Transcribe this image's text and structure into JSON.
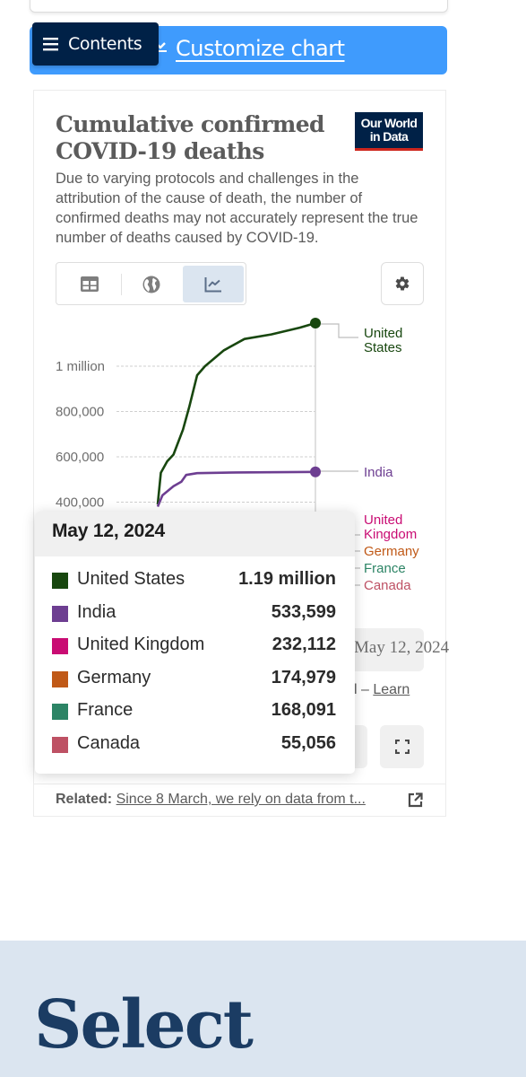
{
  "contents_button": {
    "label": "Contents",
    "icon": "menu-icon"
  },
  "customize": {
    "label": "Customize chart",
    "icon": "chevron-down-icon",
    "color": "#3f9bfd"
  },
  "chart": {
    "title": "Cumulative confirmed COVID-19 deaths",
    "subtitle": "Due to varying protocols and challenges in the attribution of the cause of death, the number of confirmed deaths may not accurately represent the true number of deaths caused by COVID-19.",
    "logo": {
      "line1": "Our World",
      "line2": "in Data"
    },
    "view_tabs": [
      {
        "name": "table",
        "icon": "table-icon",
        "active": false
      },
      {
        "name": "map",
        "icon": "globe-icon",
        "active": false
      },
      {
        "name": "chart",
        "icon": "line-chart-icon",
        "active": true
      }
    ],
    "settings_icon": "gear-icon",
    "date_control": "May 12, 2024",
    "source_line": {
      "prefix": "l – ",
      "link": "Learn"
    },
    "fullscreen_icon": "fullscreen-icon"
  },
  "tooltip": {
    "date": "May 12, 2024",
    "rows": [
      {
        "name": "United States",
        "value": "1.19 million",
        "color": "#18470f"
      },
      {
        "name": "India",
        "value": "533,599",
        "color": "#6d3e91"
      },
      {
        "name": "United Kingdom",
        "value": "232,112",
        "color": "#c90c73"
      },
      {
        "name": "Germany",
        "value": "174,979",
        "color": "#c05917"
      },
      {
        "name": "France",
        "value": "168,091",
        "color": "#2c8465"
      },
      {
        "name": "Canada",
        "value": "55,056",
        "color": "#be5164"
      }
    ]
  },
  "related": {
    "label": "Related:",
    "link": "Since 8 March, we rely on data from t..."
  },
  "select_section": {
    "heading": "Select"
  },
  "chart_data": {
    "type": "line",
    "title": "Cumulative confirmed COVID-19 deaths",
    "xlabel": "",
    "ylabel": "",
    "y_ticks": [
      400000,
      600000,
      800000,
      1000000
    ],
    "y_tick_labels": [
      "400,000",
      "600,000",
      "800,000",
      "1 million"
    ],
    "ylim": [
      0,
      1250000
    ],
    "grid": true,
    "legend": "right",
    "series": [
      {
        "name": "United States",
        "label": [
          "United",
          "States"
        ],
        "color": "#18470f",
        "points": [
          [
            0.0,
            390000
          ],
          [
            0.02,
            530000
          ],
          [
            0.06,
            580000
          ],
          [
            0.1,
            610000
          ],
          [
            0.16,
            720000
          ],
          [
            0.2,
            820000
          ],
          [
            0.25,
            960000
          ],
          [
            0.3,
            1000000
          ],
          [
            0.42,
            1070000
          ],
          [
            0.55,
            1120000
          ],
          [
            0.72,
            1140000
          ],
          [
            0.9,
            1170000
          ],
          [
            1.0,
            1190000
          ]
        ],
        "last": 1190000
      },
      {
        "name": "India",
        "label": [
          "India"
        ],
        "color": "#6d3e91",
        "points": [
          [
            0.0,
            380000
          ],
          [
            0.03,
            430000
          ],
          [
            0.1,
            470000
          ],
          [
            0.15,
            490000
          ],
          [
            0.18,
            520000
          ],
          [
            0.25,
            528000
          ],
          [
            0.5,
            531000
          ],
          [
            1.0,
            533599
          ]
        ],
        "last": 533599
      },
      {
        "name": "United Kingdom",
        "label": [
          "United",
          "Kingdom"
        ],
        "color": "#c90c73",
        "last": 232112
      },
      {
        "name": "Germany",
        "label": [
          "Germany"
        ],
        "color": "#c05917",
        "last": 174979
      },
      {
        "name": "France",
        "label": [
          "France"
        ],
        "color": "#2c8465",
        "last": 168091
      },
      {
        "name": "Canada",
        "label": [
          "Canada"
        ],
        "color": "#be5164",
        "last": 55056
      }
    ],
    "x_end_date": "May 12, 2024"
  }
}
